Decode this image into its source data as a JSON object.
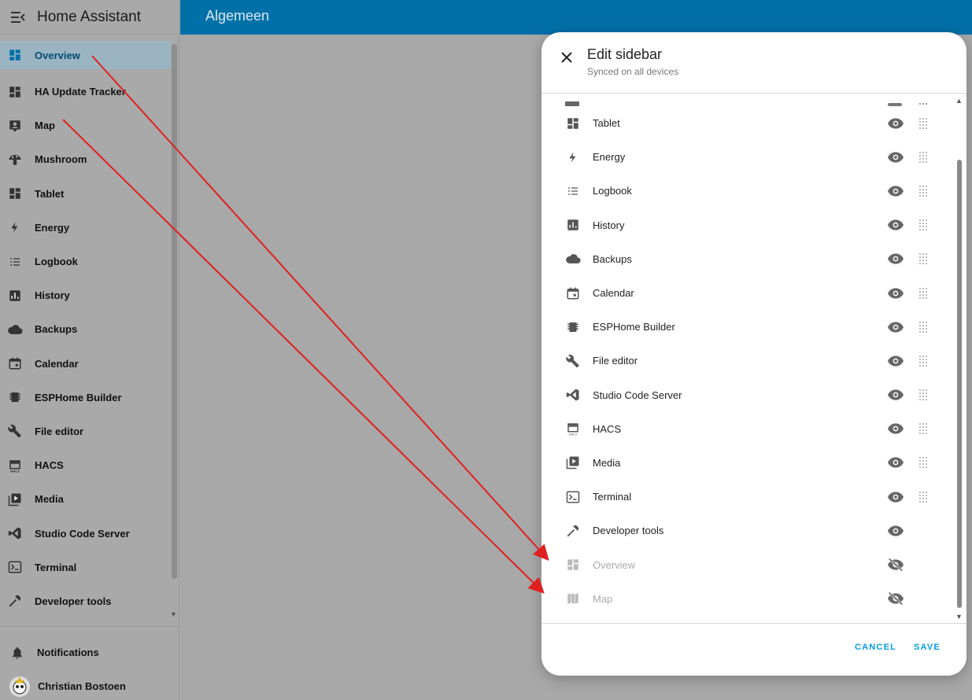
{
  "app": {
    "title": "Home Assistant"
  },
  "appbar": {
    "title": "Algemeen"
  },
  "sidebar": {
    "items": [
      {
        "label": "Overview",
        "icon": "dashboard-icon",
        "active": true
      },
      {
        "label": "HA Update Tracker",
        "icon": "dashboard-icon"
      },
      {
        "label": "Map",
        "icon": "map-account-icon"
      },
      {
        "label": "Mushroom",
        "icon": "mushroom-icon"
      },
      {
        "label": "Tablet",
        "icon": "dashboard-icon"
      },
      {
        "label": "Energy",
        "icon": "lightning-icon"
      },
      {
        "label": "Logbook",
        "icon": "list-icon"
      },
      {
        "label": "History",
        "icon": "chart-box-icon"
      },
      {
        "label": "Backups",
        "icon": "cloud-icon"
      },
      {
        "label": "Calendar",
        "icon": "calendar-icon"
      },
      {
        "label": "ESPHome Builder",
        "icon": "chip-icon"
      },
      {
        "label": "File editor",
        "icon": "wrench-icon"
      },
      {
        "label": "HACS",
        "icon": "hacs-icon"
      },
      {
        "label": "Media",
        "icon": "play-box-icon"
      },
      {
        "label": "Studio Code Server",
        "icon": "vscode-icon"
      },
      {
        "label": "Terminal",
        "icon": "console-icon"
      },
      {
        "label": "Developer tools",
        "icon": "hammer-icon"
      }
    ],
    "notifications_label": "Notifications",
    "user_name": "Christian Bostoen"
  },
  "dialog": {
    "title": "Edit sidebar",
    "subtitle": "Synced on all devices",
    "items": [
      {
        "label": "Tablet",
        "icon": "dashboard-icon",
        "visible": true
      },
      {
        "label": "Energy",
        "icon": "lightning-icon",
        "visible": true
      },
      {
        "label": "Logbook",
        "icon": "list-icon",
        "visible": true
      },
      {
        "label": "History",
        "icon": "chart-box-icon",
        "visible": true
      },
      {
        "label": "Backups",
        "icon": "cloud-icon",
        "visible": true
      },
      {
        "label": "Calendar",
        "icon": "calendar-icon",
        "visible": true
      },
      {
        "label": "ESPHome Builder",
        "icon": "chip-icon",
        "visible": true
      },
      {
        "label": "File editor",
        "icon": "wrench-icon",
        "visible": true
      },
      {
        "label": "Studio Code Server",
        "icon": "vscode-icon",
        "visible": true
      },
      {
        "label": "HACS",
        "icon": "hacs-icon",
        "visible": true
      },
      {
        "label": "Media",
        "icon": "play-box-icon",
        "visible": true
      },
      {
        "label": "Terminal",
        "icon": "console-icon",
        "visible": true
      },
      {
        "label": "Developer tools",
        "icon": "hammer-icon",
        "visible": true,
        "no_grip": true
      },
      {
        "label": "Overview",
        "icon": "dashboard-icon",
        "visible": false
      },
      {
        "label": "Map",
        "icon": "map-icon",
        "visible": false
      }
    ],
    "cancel_label": "CANCEL",
    "save_label": "SAVE"
  },
  "colors": {
    "accent": "#039be5",
    "appbar": "#0270a8",
    "annotation_arrow": "#e02020"
  }
}
